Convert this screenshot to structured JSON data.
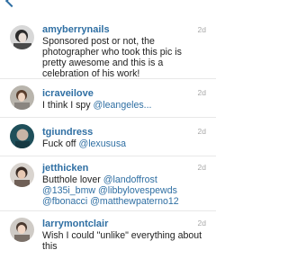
{
  "comments": [
    {
      "username": "amyberrynails",
      "time": "2d",
      "text": "Sponsored post or not, the photographer who took this pic is pretty awesome and this is a celebration of his work!"
    },
    {
      "username": "icraveilove",
      "time": "2d",
      "text_prefix": "I think I spy ",
      "mention": "@leangeles...",
      "text_suffix": ""
    },
    {
      "username": "tgiundress",
      "time": "2d",
      "text_prefix": "Fuck off ",
      "mention": "@lexususa",
      "text_suffix": ""
    },
    {
      "username": "jetthicken",
      "time": "2d",
      "text_prefix": "Butthole lover ",
      "mention": "@landoffrost @135i_bmw @libbylovespewds @fbonacci @matthewpaterno12",
      "text_suffix": ""
    },
    {
      "username": "larrymontclair",
      "time": "2d",
      "text": "Wish I could \"unlike\" everything about this"
    }
  ]
}
